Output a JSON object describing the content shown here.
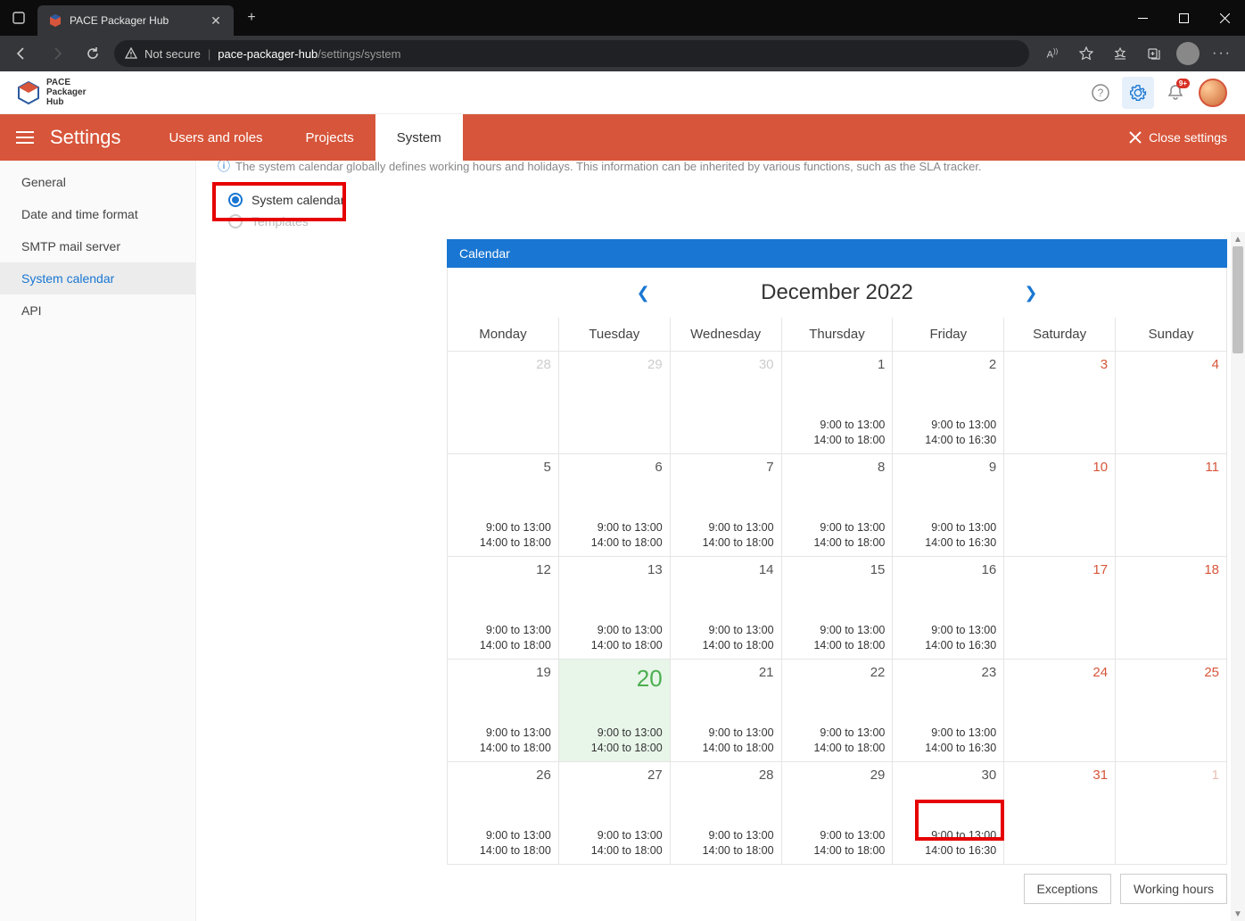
{
  "browser": {
    "tab_title": "PACE Packager Hub",
    "not_secure": "Not secure",
    "url_host": "pace-packager-hub",
    "url_path": "/settings/system"
  },
  "app": {
    "logo_lines": [
      "PACE",
      "Packager",
      "Hub"
    ],
    "notif_badge": "9+"
  },
  "nav": {
    "title": "Settings",
    "tabs": [
      "Users and roles",
      "Projects",
      "System"
    ],
    "active_tab": "System",
    "close_label": "Close settings"
  },
  "sidebar": {
    "items": [
      "General",
      "Date and time format",
      "SMTP mail server",
      "System calendar",
      "API"
    ],
    "active": "System calendar"
  },
  "info_text": "The system calendar globally defines working hours and holidays. This information can be inherited by various functions, such as the SLA tracker.",
  "radios": {
    "system_calendar": "System calendar",
    "templates": "Templates"
  },
  "calendar": {
    "header": "Calendar",
    "month_label": "December 2022",
    "weekdays": [
      "Monday",
      "Tuesday",
      "Wednesday",
      "Thursday",
      "Friday",
      "Saturday",
      "Sunday"
    ],
    "hours_std": [
      "9:00 to 13:00",
      "14:00 to 18:00"
    ],
    "hours_fri": [
      "9:00 to 13:00",
      "14:00 to 16:30"
    ],
    "weeks": [
      [
        {
          "n": "28",
          "other": true
        },
        {
          "n": "29",
          "other": true
        },
        {
          "n": "30",
          "other": true
        },
        {
          "n": "1",
          "hours": "std"
        },
        {
          "n": "2",
          "hours": "fri"
        },
        {
          "n": "3",
          "weekend": true
        },
        {
          "n": "4",
          "weekend": true
        }
      ],
      [
        {
          "n": "5",
          "hours": "std"
        },
        {
          "n": "6",
          "hours": "std"
        },
        {
          "n": "7",
          "hours": "std"
        },
        {
          "n": "8",
          "hours": "std"
        },
        {
          "n": "9",
          "hours": "fri"
        },
        {
          "n": "10",
          "weekend": true
        },
        {
          "n": "11",
          "weekend": true
        }
      ],
      [
        {
          "n": "12",
          "hours": "std"
        },
        {
          "n": "13",
          "hours": "std"
        },
        {
          "n": "14",
          "hours": "std"
        },
        {
          "n": "15",
          "hours": "std"
        },
        {
          "n": "16",
          "hours": "fri"
        },
        {
          "n": "17",
          "weekend": true
        },
        {
          "n": "18",
          "weekend": true
        }
      ],
      [
        {
          "n": "19",
          "hours": "std"
        },
        {
          "n": "20",
          "hours": "std",
          "today": true
        },
        {
          "n": "21",
          "hours": "std"
        },
        {
          "n": "22",
          "hours": "std"
        },
        {
          "n": "23",
          "hours": "fri"
        },
        {
          "n": "24",
          "weekend": true
        },
        {
          "n": "25",
          "weekend": true
        }
      ],
      [
        {
          "n": "26",
          "hours": "std"
        },
        {
          "n": "27",
          "hours": "std"
        },
        {
          "n": "28",
          "hours": "std"
        },
        {
          "n": "29",
          "hours": "std"
        },
        {
          "n": "30",
          "hours": "fri"
        },
        {
          "n": "31",
          "weekend": true
        },
        {
          "n": "1",
          "weekend": true,
          "other": true
        }
      ]
    ],
    "footer": {
      "exceptions": "Exceptions",
      "working_hours": "Working hours"
    }
  }
}
